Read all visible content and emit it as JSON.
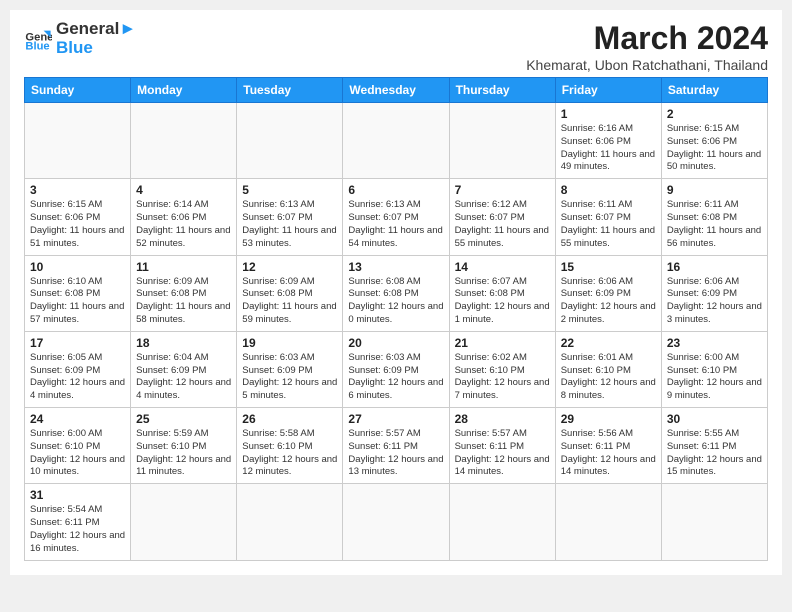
{
  "header": {
    "logo_general": "General",
    "logo_blue": "Blue",
    "title": "March 2024",
    "subtitle": "Khemarat, Ubon Ratchathani, Thailand"
  },
  "days_of_week": [
    "Sunday",
    "Monday",
    "Tuesday",
    "Wednesday",
    "Thursday",
    "Friday",
    "Saturday"
  ],
  "weeks": [
    [
      {
        "num": "",
        "info": ""
      },
      {
        "num": "",
        "info": ""
      },
      {
        "num": "",
        "info": ""
      },
      {
        "num": "",
        "info": ""
      },
      {
        "num": "",
        "info": ""
      },
      {
        "num": "1",
        "info": "Sunrise: 6:16 AM\nSunset: 6:06 PM\nDaylight: 11 hours and 49 minutes."
      },
      {
        "num": "2",
        "info": "Sunrise: 6:15 AM\nSunset: 6:06 PM\nDaylight: 11 hours and 50 minutes."
      }
    ],
    [
      {
        "num": "3",
        "info": "Sunrise: 6:15 AM\nSunset: 6:06 PM\nDaylight: 11 hours and 51 minutes."
      },
      {
        "num": "4",
        "info": "Sunrise: 6:14 AM\nSunset: 6:06 PM\nDaylight: 11 hours and 52 minutes."
      },
      {
        "num": "5",
        "info": "Sunrise: 6:13 AM\nSunset: 6:07 PM\nDaylight: 11 hours and 53 minutes."
      },
      {
        "num": "6",
        "info": "Sunrise: 6:13 AM\nSunset: 6:07 PM\nDaylight: 11 hours and 54 minutes."
      },
      {
        "num": "7",
        "info": "Sunrise: 6:12 AM\nSunset: 6:07 PM\nDaylight: 11 hours and 55 minutes."
      },
      {
        "num": "8",
        "info": "Sunrise: 6:11 AM\nSunset: 6:07 PM\nDaylight: 11 hours and 55 minutes."
      },
      {
        "num": "9",
        "info": "Sunrise: 6:11 AM\nSunset: 6:08 PM\nDaylight: 11 hours and 56 minutes."
      }
    ],
    [
      {
        "num": "10",
        "info": "Sunrise: 6:10 AM\nSunset: 6:08 PM\nDaylight: 11 hours and 57 minutes."
      },
      {
        "num": "11",
        "info": "Sunrise: 6:09 AM\nSunset: 6:08 PM\nDaylight: 11 hours and 58 minutes."
      },
      {
        "num": "12",
        "info": "Sunrise: 6:09 AM\nSunset: 6:08 PM\nDaylight: 11 hours and 59 minutes."
      },
      {
        "num": "13",
        "info": "Sunrise: 6:08 AM\nSunset: 6:08 PM\nDaylight: 12 hours and 0 minutes."
      },
      {
        "num": "14",
        "info": "Sunrise: 6:07 AM\nSunset: 6:08 PM\nDaylight: 12 hours and 1 minute."
      },
      {
        "num": "15",
        "info": "Sunrise: 6:06 AM\nSunset: 6:09 PM\nDaylight: 12 hours and 2 minutes."
      },
      {
        "num": "16",
        "info": "Sunrise: 6:06 AM\nSunset: 6:09 PM\nDaylight: 12 hours and 3 minutes."
      }
    ],
    [
      {
        "num": "17",
        "info": "Sunrise: 6:05 AM\nSunset: 6:09 PM\nDaylight: 12 hours and 4 minutes."
      },
      {
        "num": "18",
        "info": "Sunrise: 6:04 AM\nSunset: 6:09 PM\nDaylight: 12 hours and 4 minutes."
      },
      {
        "num": "19",
        "info": "Sunrise: 6:03 AM\nSunset: 6:09 PM\nDaylight: 12 hours and 5 minutes."
      },
      {
        "num": "20",
        "info": "Sunrise: 6:03 AM\nSunset: 6:09 PM\nDaylight: 12 hours and 6 minutes."
      },
      {
        "num": "21",
        "info": "Sunrise: 6:02 AM\nSunset: 6:10 PM\nDaylight: 12 hours and 7 minutes."
      },
      {
        "num": "22",
        "info": "Sunrise: 6:01 AM\nSunset: 6:10 PM\nDaylight: 12 hours and 8 minutes."
      },
      {
        "num": "23",
        "info": "Sunrise: 6:00 AM\nSunset: 6:10 PM\nDaylight: 12 hours and 9 minutes."
      }
    ],
    [
      {
        "num": "24",
        "info": "Sunrise: 6:00 AM\nSunset: 6:10 PM\nDaylight: 12 hours and 10 minutes."
      },
      {
        "num": "25",
        "info": "Sunrise: 5:59 AM\nSunset: 6:10 PM\nDaylight: 12 hours and 11 minutes."
      },
      {
        "num": "26",
        "info": "Sunrise: 5:58 AM\nSunset: 6:10 PM\nDaylight: 12 hours and 12 minutes."
      },
      {
        "num": "27",
        "info": "Sunrise: 5:57 AM\nSunset: 6:11 PM\nDaylight: 12 hours and 13 minutes."
      },
      {
        "num": "28",
        "info": "Sunrise: 5:57 AM\nSunset: 6:11 PM\nDaylight: 12 hours and 14 minutes."
      },
      {
        "num": "29",
        "info": "Sunrise: 5:56 AM\nSunset: 6:11 PM\nDaylight: 12 hours and 14 minutes."
      },
      {
        "num": "30",
        "info": "Sunrise: 5:55 AM\nSunset: 6:11 PM\nDaylight: 12 hours and 15 minutes."
      }
    ],
    [
      {
        "num": "31",
        "info": "Sunrise: 5:54 AM\nSunset: 6:11 PM\nDaylight: 12 hours and 16 minutes."
      },
      {
        "num": "",
        "info": ""
      },
      {
        "num": "",
        "info": ""
      },
      {
        "num": "",
        "info": ""
      },
      {
        "num": "",
        "info": ""
      },
      {
        "num": "",
        "info": ""
      },
      {
        "num": "",
        "info": ""
      }
    ]
  ]
}
